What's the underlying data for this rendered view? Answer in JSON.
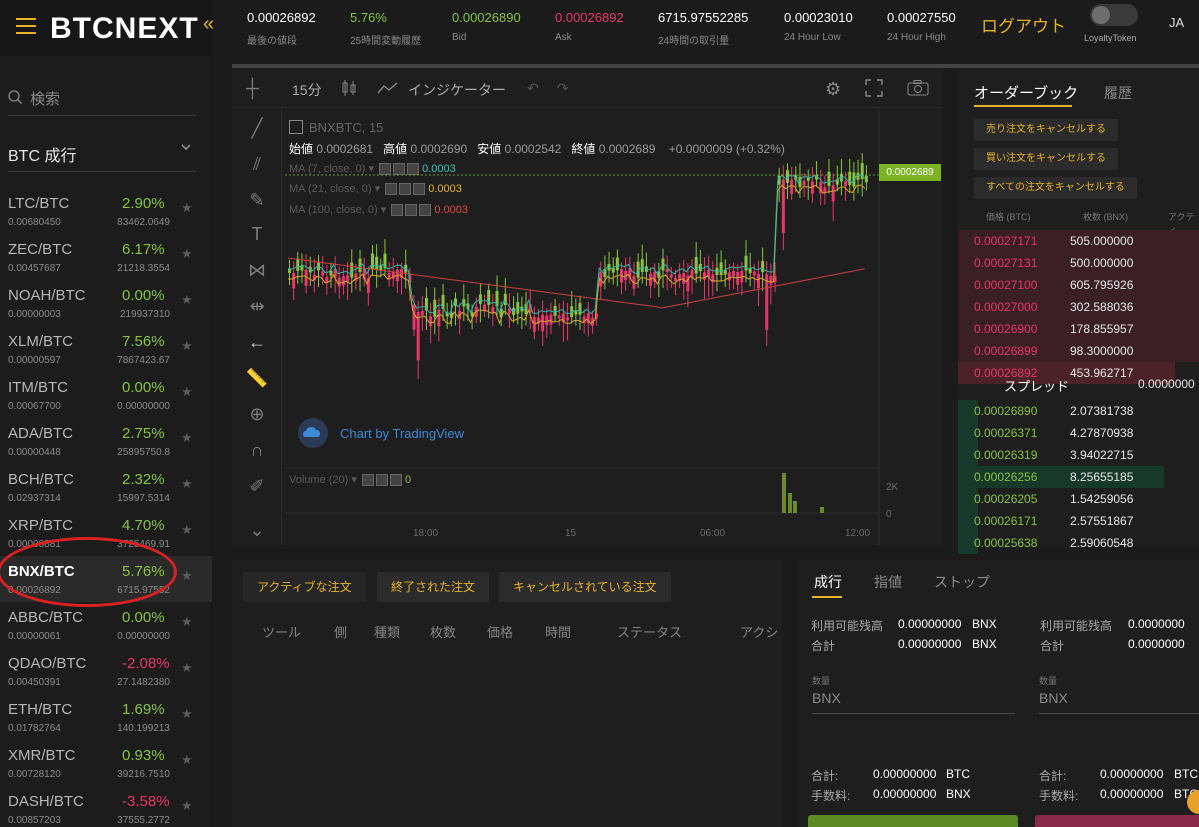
{
  "brand": {
    "name": "BTCNEXT",
    "accent": "#e8b32b",
    "up": "#8ac43f",
    "down": "#e8366a"
  },
  "ticker": [
    {
      "value": "0.00026892",
      "label": "最後の値段",
      "color": "#ffffff"
    },
    {
      "value": "5.76%",
      "label": "25時間変動履歴",
      "color": "#8ac43f"
    },
    {
      "value": "0.00026890",
      "label": "Bid",
      "color": "#8ac43f"
    },
    {
      "value": "0.00026892",
      "label": "Ask",
      "color": "#e8366a"
    },
    {
      "value": "6715.97552285",
      "label": "24時間の取引量",
      "color": "#ffffff"
    },
    {
      "value": "0.00023010",
      "label": "24 Hour Low",
      "color": "#ffffff"
    },
    {
      "value": "0.00027550",
      "label": "24 Hour High",
      "color": "#ffffff"
    }
  ],
  "header": {
    "logout": "ログアウト",
    "loyalty": "LoyaltyToken",
    "lang": "JA"
  },
  "sidebar": {
    "search_placeholder": "検索",
    "market": "BTC 成行",
    "pairs": [
      {
        "name": "LTC/BTC",
        "change": "2.90%",
        "price": "0.00680450",
        "volume": "83462.0649",
        "dir": "up"
      },
      {
        "name": "ZEC/BTC",
        "change": "6.17%",
        "price": "0.00457687",
        "volume": "21218.3554",
        "dir": "up"
      },
      {
        "name": "NOAH/BTC",
        "change": "0.00%",
        "price": "0.00000003",
        "volume": "219937310",
        "dir": "up"
      },
      {
        "name": "XLM/BTC",
        "change": "7.56%",
        "price": "0.00000597",
        "volume": "7867423.67",
        "dir": "up"
      },
      {
        "name": "ITM/BTC",
        "change": "0.00%",
        "price": "0.00067700",
        "volume": "0.00000000",
        "dir": "up"
      },
      {
        "name": "ADA/BTC",
        "change": "2.75%",
        "price": "0.00000448",
        "volume": "25895750.8",
        "dir": "up"
      },
      {
        "name": "BCH/BTC",
        "change": "2.32%",
        "price": "0.02937314",
        "volume": "15997.5314",
        "dir": "up"
      },
      {
        "name": "XRP/BTC",
        "change": "4.70%",
        "price": "0.00008881",
        "volume": "3725469.91",
        "dir": "up"
      },
      {
        "name": "BNX/BTC",
        "change": "5.76%",
        "price": "0.00026892",
        "volume": "6715.97552",
        "dir": "up",
        "selected": true
      },
      {
        "name": "ABBC/BTC",
        "change": "0.00%",
        "price": "0.00000061",
        "volume": "0.00000000",
        "dir": "up"
      },
      {
        "name": "QDAO/BTC",
        "change": "-2.08%",
        "price": "0.00450391",
        "volume": "27.1482380",
        "dir": "dn"
      },
      {
        "name": "ETH/BTC",
        "change": "1.69%",
        "price": "0.01782764",
        "volume": "140.199213",
        "dir": "up"
      },
      {
        "name": "XMR/BTC",
        "change": "0.93%",
        "price": "0.00728120",
        "volume": "39216.7510",
        "dir": "up"
      },
      {
        "name": "DASH/BTC",
        "change": "-3.58%",
        "price": "0.00857203",
        "volume": "37555.2772",
        "dir": "dn"
      }
    ]
  },
  "chart": {
    "interval": "15分",
    "indicator_label": "インジケーター",
    "symbol": "BNXBTC, 15",
    "open_label": "始値",
    "open": "0.0002681",
    "high_label": "高値",
    "high": "0.0002690",
    "low_label": "安値",
    "low": "0.0002542",
    "close_label": "終値",
    "close": "0.0002689",
    "delta": "+0.0000009 (+0.32%)",
    "ma1": "MA (7, close, 0)",
    "ma1_val": "0.0003",
    "ma2": "MA (21, close, 0)",
    "ma2_val": "0.0003",
    "ma3": "MA (100, close, 0)",
    "ma3_val": "0.0003",
    "price_tag": "0.0002689",
    "tradingview": "Chart by TradingView",
    "volume_label": "Volume (20)",
    "volume_val": "0",
    "x_ticks": [
      "18:00",
      "15",
      "06:00",
      "12:00"
    ],
    "vol_ticks": [
      "2K",
      "0"
    ]
  },
  "orderbook": {
    "tab_active": "オーダーブック",
    "tab_other": "履歴",
    "cancel_sell": "売り注文をキャンセルする",
    "cancel_buy": "買い注文をキャンセルする",
    "cancel_all": "すべての注文をキャンセルする",
    "col_price": "価格 (BTC)",
    "col_qty": "枚数 (BNX)",
    "col_action": "アクティ",
    "asks": [
      {
        "price": "0.00027171",
        "qty": "505.000000"
      },
      {
        "price": "0.00027131",
        "qty": "500.000000"
      },
      {
        "price": "0.00027100",
        "qty": "605.795926"
      },
      {
        "price": "0.00027000",
        "qty": "302.588036"
      },
      {
        "price": "0.00026900",
        "qty": "178.855957"
      },
      {
        "price": "0.00026899",
        "qty": "98.3000000"
      },
      {
        "price": "0.00026892",
        "qty": "453.962717"
      }
    ],
    "spread_label": "スプレッド",
    "spread": "0.0000000",
    "bids": [
      {
        "price": "0.00026890",
        "qty": "2.07381738"
      },
      {
        "price": "0.00026371",
        "qty": "4.27870938"
      },
      {
        "price": "0.00026319",
        "qty": "3.94022715"
      },
      {
        "price": "0.00026256",
        "qty": "8.25655185"
      },
      {
        "price": "0.00026205",
        "qty": "1.54259056"
      },
      {
        "price": "0.00026171",
        "qty": "2.57551867"
      },
      {
        "price": "0.00025638",
        "qty": "2.59060548"
      }
    ]
  },
  "orders": {
    "tabs": [
      "アクティブな注文",
      "終了された注文",
      "キャンセルされている注文"
    ],
    "columns": [
      "ツール",
      "側",
      "種類",
      "枚数",
      "価格",
      "時間",
      "ステータス",
      "アクシ"
    ]
  },
  "trade": {
    "tabs": [
      "成行",
      "指値",
      "ストップ"
    ],
    "balance_label": "利用可能残高",
    "total_label": "合計",
    "buy_balance": "0.00000000",
    "buy_unit": "BNX",
    "buy_total": "0.00000000",
    "buy_total_unit": "BNX",
    "sell_balance": "0.0000000",
    "sell_total": "0.0000000",
    "qty_label": "数量",
    "qty_placeholder": "BNX",
    "sum_label": "合計:",
    "fee_label": "手数料:",
    "buy_sum": "0.00000000",
    "buy_sum_unit": "BTC",
    "buy_fee": "0.00000000",
    "buy_fee_unit": "BNX",
    "sell_sum": "0.00000000",
    "sell_sum_unit": "BTC",
    "sell_fee": "0.00000000",
    "sell_fee_unit": "BTC"
  }
}
